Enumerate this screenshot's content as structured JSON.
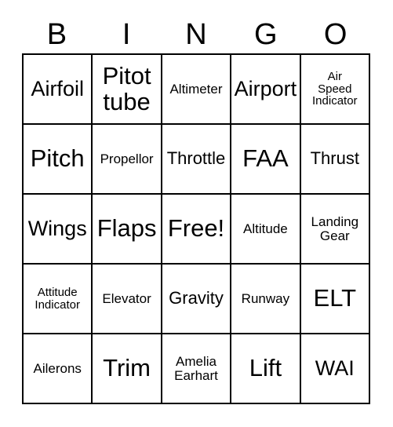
{
  "card": {
    "header": {
      "letters": [
        "B",
        "I",
        "N",
        "G",
        "O"
      ]
    },
    "rows": [
      [
        {
          "text": "Airfoil",
          "size": "fs-lg"
        },
        {
          "text": "Pitot\ntube",
          "size": "fs-xl"
        },
        {
          "text": "Altimeter",
          "size": "fs-sm"
        },
        {
          "text": "Airport",
          "size": "fs-lg"
        },
        {
          "text": "Air\nSpeed\nIndicator",
          "size": "fs-xs"
        }
      ],
      [
        {
          "text": "Pitch",
          "size": "fs-xl"
        },
        {
          "text": "Propellor",
          "size": "fs-sm"
        },
        {
          "text": "Throttle",
          "size": "fs-md"
        },
        {
          "text": "FAA",
          "size": "fs-xl"
        },
        {
          "text": "Thrust",
          "size": "fs-md"
        }
      ],
      [
        {
          "text": "Wings",
          "size": "fs-lg"
        },
        {
          "text": "Flaps",
          "size": "fs-xl"
        },
        {
          "text": "Free!",
          "size": "fs-xl"
        },
        {
          "text": "Altitude",
          "size": "fs-sm"
        },
        {
          "text": "Landing\nGear",
          "size": "fs-sm"
        }
      ],
      [
        {
          "text": "Attitude\nIndicator",
          "size": "fs-xs"
        },
        {
          "text": "Elevator",
          "size": "fs-sm"
        },
        {
          "text": "Gravity",
          "size": "fs-md"
        },
        {
          "text": "Runway",
          "size": "fs-sm"
        },
        {
          "text": "ELT",
          "size": "fs-xl"
        }
      ],
      [
        {
          "text": "Ailerons",
          "size": "fs-sm"
        },
        {
          "text": "Trim",
          "size": "fs-xl"
        },
        {
          "text": "Amelia\nEarhart",
          "size": "fs-sm"
        },
        {
          "text": "Lift",
          "size": "fs-xl"
        },
        {
          "text": "WAI",
          "size": "fs-lg"
        }
      ]
    ]
  },
  "colors": {
    "ink": "#000000",
    "paper": "#ffffff"
  }
}
